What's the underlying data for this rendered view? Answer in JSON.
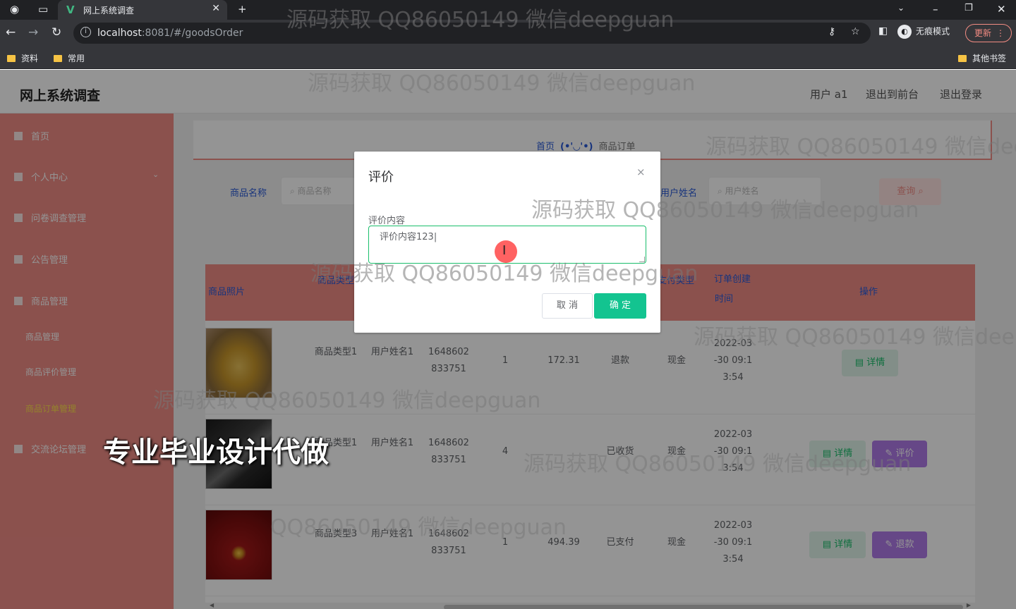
{
  "browser": {
    "tab_title": "网上系统调查",
    "url_host": "localhost",
    "url_port": ":8081",
    "url_path": "/#/goodsOrder",
    "incognito_label": "无痕模式",
    "update_label": "更新",
    "bookmarks": [
      "资料",
      "常用"
    ],
    "other_bookmarks": "其他书签"
  },
  "header": {
    "site_title": "网上系统调查",
    "user_label": "用户 a1",
    "back_front_label": "退出到前台",
    "logout_label": "退出登录"
  },
  "sidebar": {
    "items": [
      "首页",
      "个人中心",
      "问卷调查管理",
      "公告管理",
      "商品管理",
      "交流论坛管理"
    ],
    "sub_items": [
      "商品管理",
      "商品评价管理",
      "商品订单管理"
    ]
  },
  "breadcrumb": {
    "home": "首页",
    "face": "(•'◡'•)",
    "current": "商品订单"
  },
  "search": {
    "goods_name_label": "商品名称",
    "goods_name_placeholder": "商品名称",
    "user_name_label": "用户姓名",
    "user_name_placeholder": "用户姓名",
    "query_label": "查询"
  },
  "table": {
    "headers": {
      "photo": "商品照片",
      "type": "商品类型",
      "pay_type": "支付类型",
      "created_1": "订单创建",
      "created_2": "时间",
      "ops": "操作"
    },
    "rows": [
      {
        "type": "商品类型1",
        "user": "用户姓名1",
        "order_no_1": "1648602",
        "order_no_2": "833751",
        "qty": "1",
        "price": "172.31",
        "status": "退款",
        "pay": "现金",
        "time_1": "2022-03",
        "time_2": "-30 09:1",
        "time_3": "3:54"
      },
      {
        "type": "商品类型1",
        "user": "用户姓名1",
        "order_no_1": "1648602",
        "order_no_2": "833751",
        "qty": "4",
        "price": "",
        "status": "已收货",
        "pay": "现金",
        "time_1": "2022-03",
        "time_2": "-30 09:1",
        "time_3": "3:54"
      },
      {
        "type": "商品类型3",
        "user": "用户姓名1",
        "order_no_1": "1648602",
        "order_no_2": "833751",
        "qty": "1",
        "price": "494.39",
        "status": "已支付",
        "pay": "现金",
        "time_1": "2022-03",
        "time_2": "-30 09:1",
        "time_3": "3:54"
      }
    ],
    "detail_label": "详情",
    "review_label": "评价",
    "refund_label": "退款"
  },
  "dialog": {
    "title": "评价",
    "close_glyph": "×",
    "field_label": "评价内容",
    "field_value": "评价内容123",
    "cancel_label": "取 消",
    "confirm_label": "确 定"
  },
  "watermark": "源码获取 QQ86050149 微信deepguan",
  "watermark_cut1": "源码获取 QQ86050149 微信dee",
  "watermark_cut2": "源码获取 QQ86050149 微信deep",
  "watermark_cut3": "QQ86050149 微信deepguan",
  "promo": "专业毕业设计代做",
  "colors": {
    "accent": "#f08c86",
    "link": "#2a5bd7",
    "confirm": "#13c490",
    "purple": "#b07ae8"
  }
}
